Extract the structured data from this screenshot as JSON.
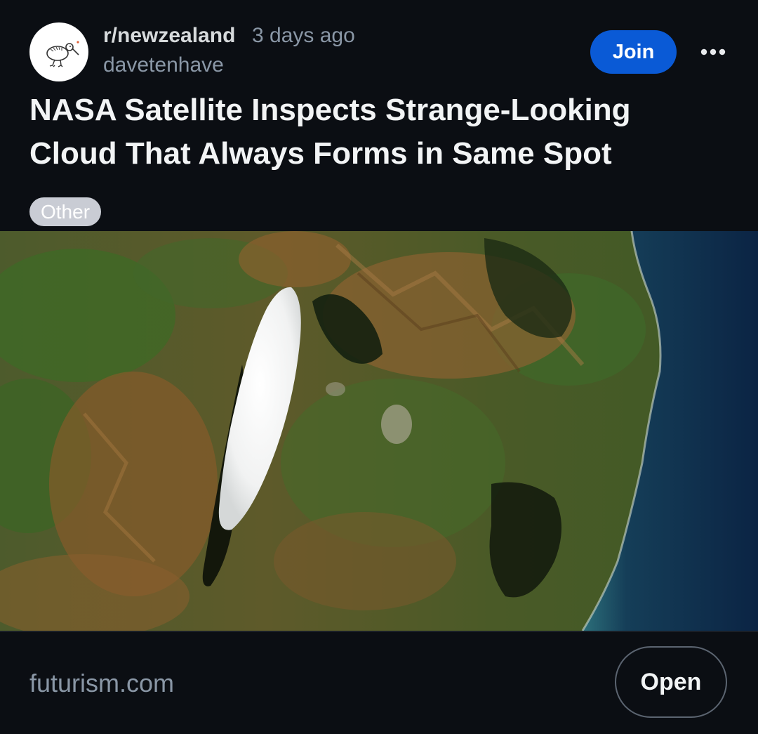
{
  "header": {
    "subreddit": "r/newzealand",
    "time_ago": "3 days ago",
    "username": "davetenhave",
    "avatar_icon": "kiwi-bird-icon",
    "join_label": "Join",
    "more_icon": "more-horizontal-icon"
  },
  "post": {
    "title": "NASA Satellite Inspects Strange-Looking Cloud That Always Forms in Same Spot",
    "flair": "Other"
  },
  "footer": {
    "domain": "futurism.com",
    "open_label": "Open"
  },
  "colors": {
    "background": "#0b0e13",
    "join_button": "#0a5ad6",
    "flair_bg": "#c9ccd4",
    "muted_text": "#8a97a6"
  }
}
